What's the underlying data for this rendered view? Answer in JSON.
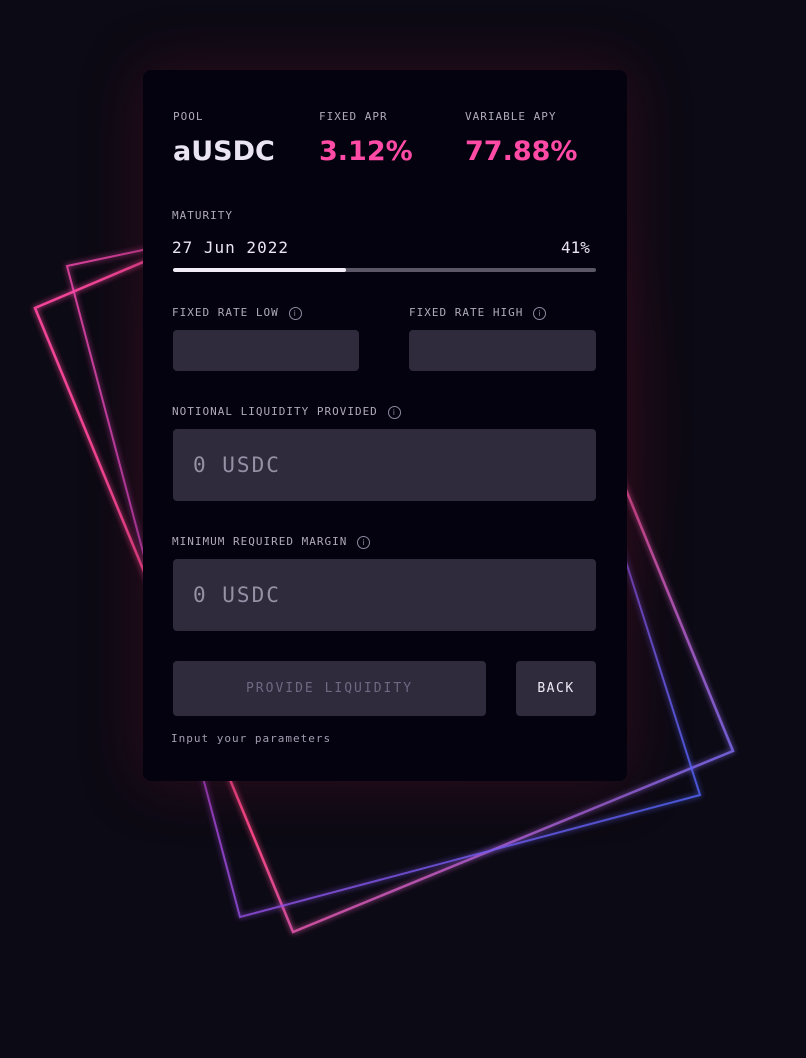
{
  "pool": {
    "label": "POOL",
    "value": "aUSDC"
  },
  "fixed_apr": {
    "label": "FIXED APR",
    "value": "3.12%"
  },
  "variable_apy": {
    "label": "VARIABLE APY",
    "value": "77.88%"
  },
  "maturity": {
    "label": "MATURITY",
    "date": "27 Jun 2022",
    "progress_text": "41%",
    "progress": 0.41
  },
  "fixed_rate_low": {
    "label": "FIXED RATE LOW",
    "value": ""
  },
  "fixed_rate_high": {
    "label": "FIXED RATE HIGH",
    "value": ""
  },
  "notional_liquidity": {
    "label": "NOTIONAL LIQUIDITY PROVIDED",
    "value": "0 USDC"
  },
  "minimum_margin": {
    "label": "MINIMUM REQUIRED MARGIN",
    "value": "0 USDC"
  },
  "actions": {
    "provide_label": "PROVIDE LIQUIDITY",
    "back_label": "BACK"
  },
  "hint": "Input your parameters",
  "icons": {
    "info": "info-icon"
  },
  "colors": {
    "accent_pink": "#ff4aa6",
    "card_bg": "#04020f",
    "field_bg": "#2f2b3d",
    "decor_blue": "#3f6cff"
  }
}
